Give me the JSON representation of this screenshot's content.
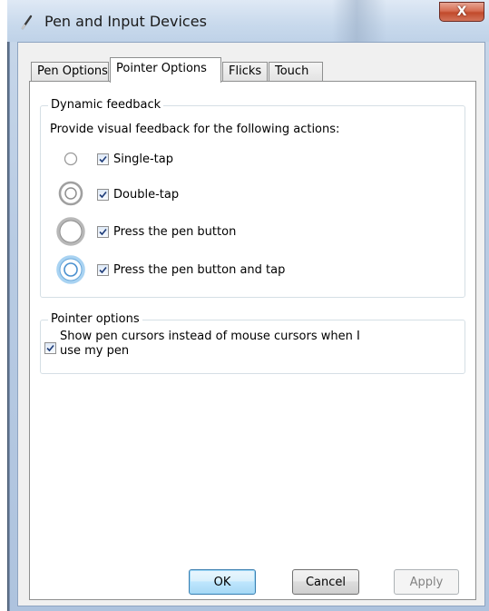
{
  "window": {
    "title": "Pen and Input Devices",
    "close_label": "X",
    "accent_color": "#c24a2b"
  },
  "tabs": [
    {
      "label": "Pen Options",
      "active": false
    },
    {
      "label": "Pointer Options",
      "active": true
    },
    {
      "label": "Flicks",
      "active": false
    },
    {
      "label": "Touch",
      "active": false
    }
  ],
  "dynamic_feedback": {
    "title": "Dynamic feedback",
    "description": "Provide visual feedback for the following actions:",
    "items": [
      {
        "label": "Single-tap",
        "checked": true,
        "icon": "single-tap-ring-icon"
      },
      {
        "label": "Double-tap",
        "checked": true,
        "icon": "double-tap-ring-icon"
      },
      {
        "label": "Press the pen button",
        "checked": true,
        "icon": "press-button-ring-icon"
      },
      {
        "label": "Press the pen button and tap",
        "checked": true,
        "icon": "press-button-tap-ring-icon"
      }
    ]
  },
  "pointer_options": {
    "title": "Pointer options",
    "show_cursors_label_line1": "Show pen cursors instead of mouse cursors when I",
    "show_cursors_label_line2": "use my pen",
    "show_cursors_checked": true
  },
  "buttons": {
    "ok": "OK",
    "cancel": "Cancel",
    "apply": "Apply"
  }
}
